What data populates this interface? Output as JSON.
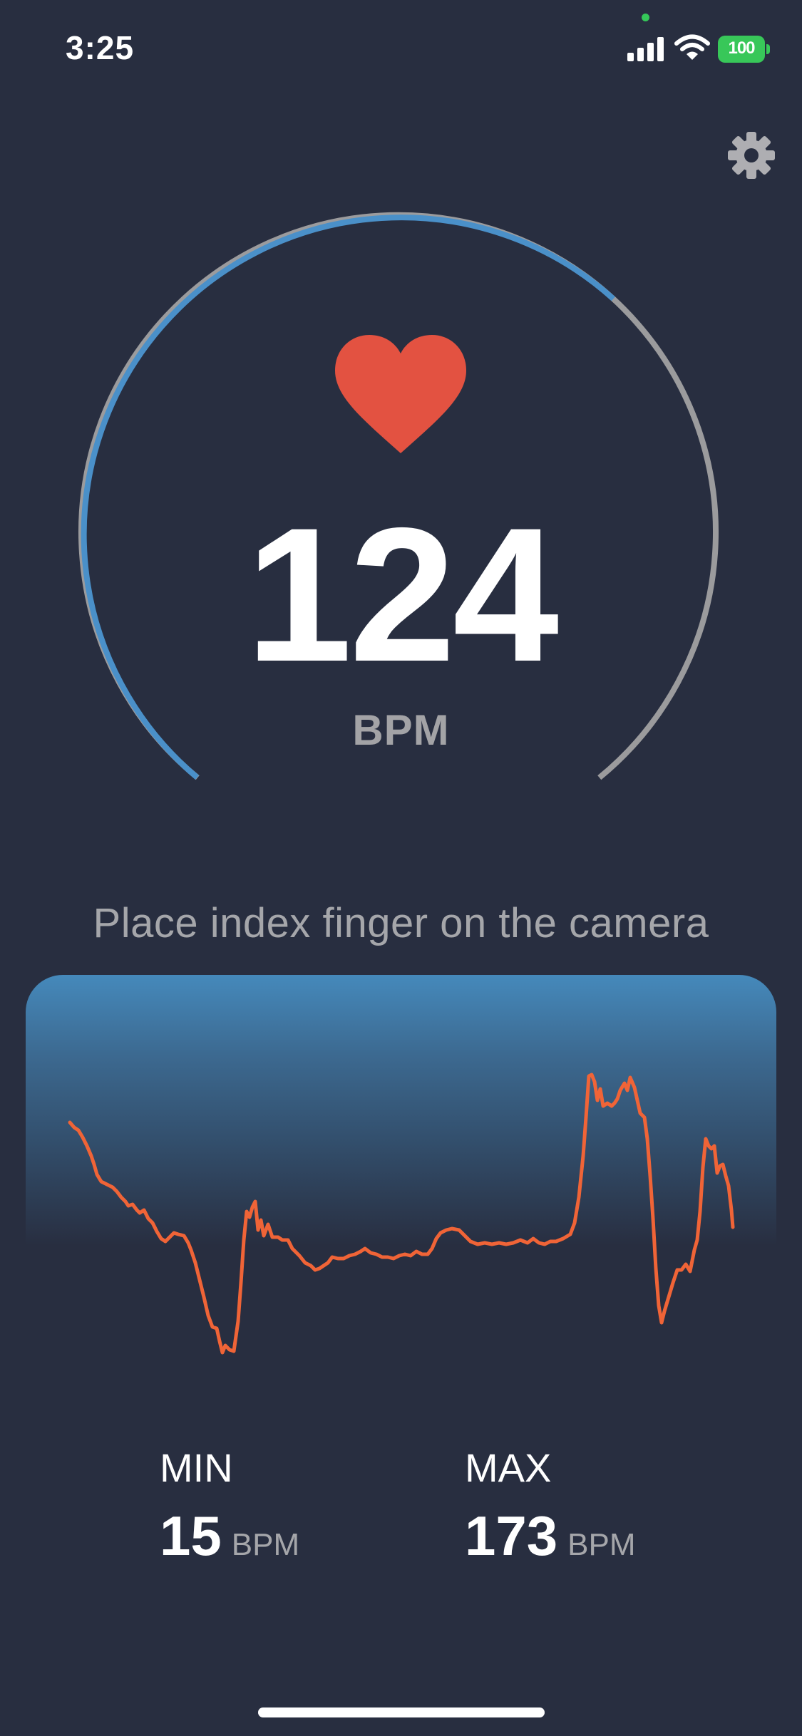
{
  "status_bar": {
    "time": "3:25",
    "battery_level": "100",
    "icons": [
      "cellular-signal-icon",
      "wifi-icon",
      "battery-charging-icon"
    ]
  },
  "header": {
    "settings_icon": "gear-icon"
  },
  "heart_rate": {
    "value": "124",
    "unit": "BPM",
    "icon": "heart-icon",
    "gauge_progress_fraction": 0.7,
    "colors": {
      "progress": "#4a90c9",
      "track": "#9b9b9d",
      "heart": "#e35241"
    }
  },
  "instruction": "Place index finger on the camera",
  "graph": {
    "line_color": "#f06437",
    "gradient_top": "#4589bb",
    "background": "#282e40"
  },
  "stats": {
    "min": {
      "label": "MIN",
      "value": "15",
      "unit": "BPM"
    },
    "max": {
      "label": "MAX",
      "value": "173",
      "unit": "BPM"
    }
  }
}
